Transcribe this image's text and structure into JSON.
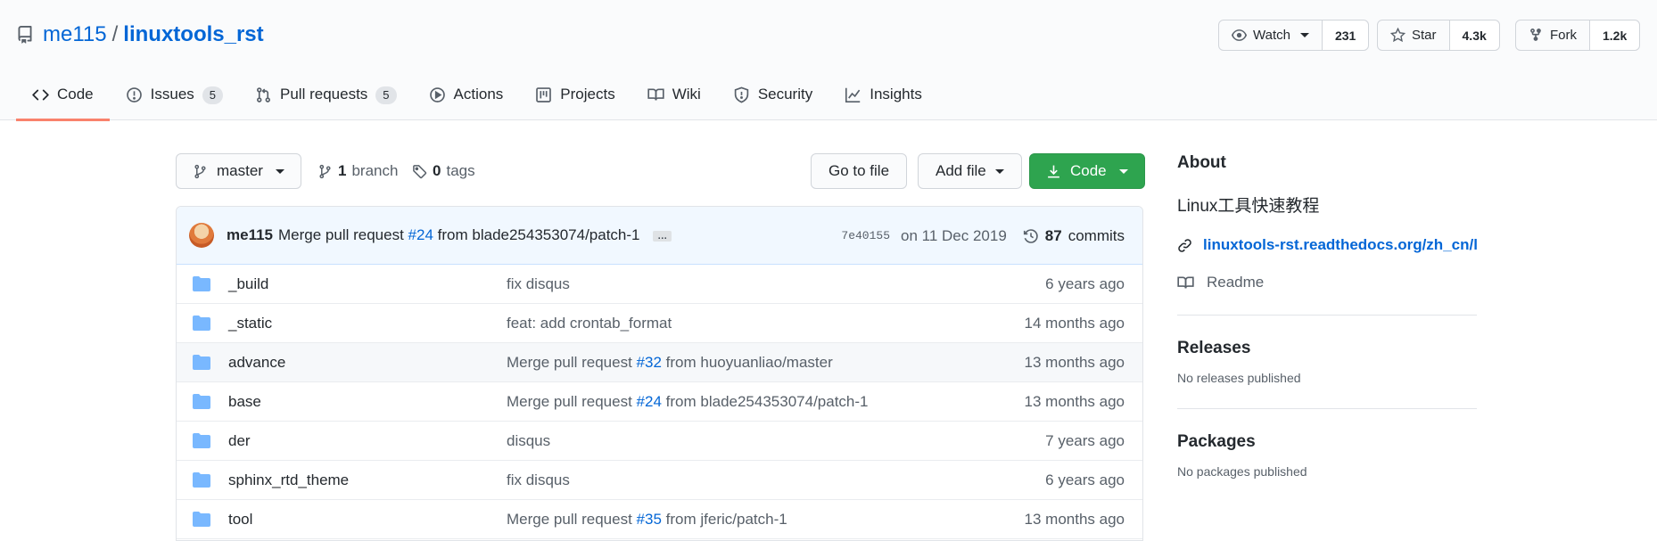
{
  "repo": {
    "owner": "me115",
    "separator": "/",
    "name": "linuxtools_rst"
  },
  "header_actions": {
    "watch": {
      "label": "Watch",
      "count": "231"
    },
    "star": {
      "label": "Star",
      "count": "4.3k"
    },
    "fork": {
      "label": "Fork",
      "count": "1.2k"
    }
  },
  "tabs": [
    {
      "label": "Code",
      "icon": "code-icon",
      "active": true
    },
    {
      "label": "Issues",
      "icon": "issue-opened-icon",
      "badge": "5"
    },
    {
      "label": "Pull requests",
      "icon": "git-pull-request-icon",
      "badge": "5"
    },
    {
      "label": "Actions",
      "icon": "play-icon"
    },
    {
      "label": "Projects",
      "icon": "project-icon"
    },
    {
      "label": "Wiki",
      "icon": "book-icon"
    },
    {
      "label": "Security",
      "icon": "shield-icon"
    },
    {
      "label": "Insights",
      "icon": "graph-icon"
    }
  ],
  "toolbar": {
    "branch": "master",
    "branch_count": "1",
    "branch_label": "branch",
    "tag_count": "0",
    "tag_label": "tags",
    "go_to_file": "Go to file",
    "add_file": "Add file",
    "code": "Code"
  },
  "commit": {
    "author": "me115",
    "message_prefix": "Merge pull request",
    "pr": "#24",
    "message_suffix": "from blade254353074/patch-1",
    "ellipsis": "…",
    "sha": "7e40155",
    "date": "on 11 Dec 2019",
    "commit_count": "87",
    "commit_label": "commits"
  },
  "files": [
    {
      "name": "_build",
      "msg": "fix disqus",
      "age": "6 years ago"
    },
    {
      "name": "_static",
      "msg": "feat: add crontab_format",
      "age": "14 months ago"
    },
    {
      "name": "advance",
      "msg_prefix": "Merge pull request",
      "pr": "#32",
      "msg_suffix": "from huoyuanliao/master",
      "age": "13 months ago"
    },
    {
      "name": "base",
      "msg_prefix": "Merge pull request",
      "pr": "#24",
      "msg_suffix": "from blade254353074/patch-1",
      "age": "13 months ago"
    },
    {
      "name": "der",
      "msg": "disqus",
      "age": "7 years ago"
    },
    {
      "name": "sphinx_rtd_theme",
      "msg": "fix disqus",
      "age": "6 years ago"
    },
    {
      "name": "tool",
      "msg_prefix": "Merge pull request",
      "pr": "#35",
      "msg_suffix": "from jferic/patch-1",
      "age": "13 months ago"
    }
  ],
  "about": {
    "heading": "About",
    "description": "Linux工具快速教程",
    "link": "linuxtools-rst.readthedocs.org/zh_cn/l...",
    "readme": "Readme"
  },
  "releases": {
    "heading": "Releases",
    "empty": "No releases published"
  },
  "packages": {
    "heading": "Packages",
    "empty": "No packages published"
  },
  "colors": {
    "link": "#0366d6",
    "green": "#2ea44f",
    "active_tab": "#f9826c",
    "folder": "#79b8ff"
  }
}
